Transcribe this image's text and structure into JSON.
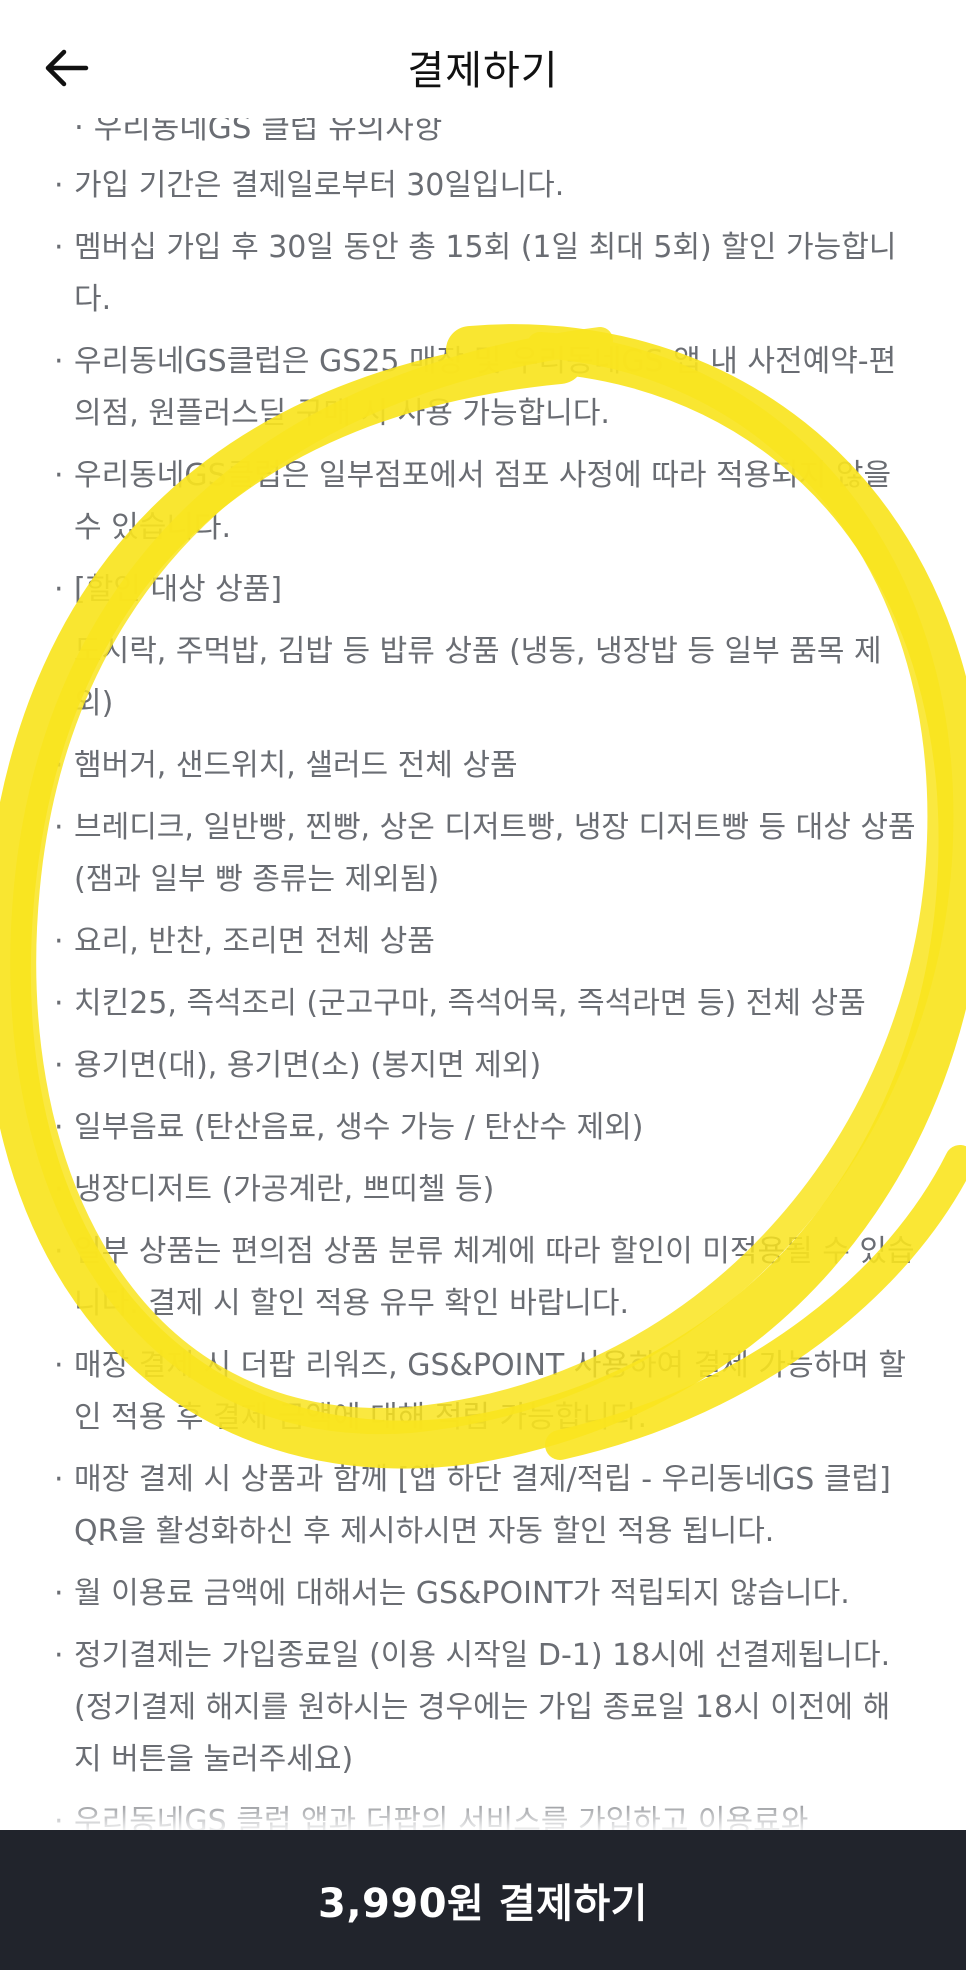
{
  "header": {
    "title": "결제하기",
    "back_icon": "arrow-left-icon"
  },
  "content": {
    "cut_off_heading": "· 우리동네GS 클럽 유의사항",
    "notes": [
      {
        "bullet": "·",
        "text": "가입 기간은 결제일로부터 30일입니다."
      },
      {
        "bullet": "·",
        "text": "멤버십 가입 후 30일 동안 총 15회 (1일 최대 5회) 할인 가능합니다."
      },
      {
        "bullet": "·",
        "text": "우리동네GS클럽은 GS25 매장 및 우리동네GS 앱 내 사전예약-편의점, 원플러스딜 구매 시 사용 가능합니다."
      },
      {
        "bullet": "·",
        "text": "우리동네GS클럽은 일부점포에서 점포 사정에 따라 적용되지 않을 수 있습니다."
      },
      {
        "bullet": "·",
        "text": "[할인 대상 상품]"
      },
      {
        "bullet": "",
        "text": "도시락, 주먹밥, 김밥 등 밥류 상품 (냉동, 냉장밥 등 일부 품목 제외)"
      },
      {
        "bullet": "·",
        "text": "햄버거, 샌드위치, 샐러드 전체 상품"
      },
      {
        "bullet": "·",
        "text": "브레디크, 일반빵, 찐빵, 상온 디저트빵, 냉장 디저트빵 등 대상 상품 (잼과 일부 빵 종류는 제외됨)"
      },
      {
        "bullet": "·",
        "text": "요리, 반찬, 조리면 전체 상품"
      },
      {
        "bullet": "·",
        "text": "치킨25, 즉석조리 (군고구마, 즉석어묵, 즉석라면 등) 전체 상품"
      },
      {
        "bullet": "·",
        "text": "용기면(대), 용기면(소) (봉지면 제외)"
      },
      {
        "bullet": "·",
        "text": "일부음료 (탄산음료, 생수 가능 / 탄산수 제외)"
      },
      {
        "bullet": "·",
        "text": "냉장디저트 (가공계란, 쁘띠첼 등)"
      },
      {
        "bullet": "·",
        "text": "일부 상품는 편의점 상품 분류 체계에 따라 할인이 미적용될 수 있습니다. 결제 시 할인 적용 유무 확인 바랍니다."
      },
      {
        "bullet": "·",
        "text": "매장 결제 시 더팝 리워즈, GS&POINT 사용하여 결제 가능하며 할인 적용 후 결제 금액에 대해 적립 가능합니다."
      },
      {
        "bullet": "·",
        "text": "매장 결제 시 상품과 함께 [앱 하단 결제/적립 - 우리동네GS 클럽] QR을 활성화하신 후 제시하시면 자동 할인 적용 됩니다."
      },
      {
        "bullet": "·",
        "text": "월 이용료 금액에 대해서는 GS&POINT가 적립되지 않습니다."
      },
      {
        "bullet": "·",
        "text": "정기결제는 가입종료일 (이용 시작일 D-1) 18시에 선결제됩니다. (정기결제 해지를 원하시는 경우에는 가입 종료일 18시 이전에 해지 버튼을 눌러주세요)"
      },
      {
        "bullet": "·",
        "text": "우리동네GS 클럽 앱과 더팝의 서비스를 가입하고 이용료와"
      }
    ]
  },
  "annotation": {
    "shape": "hand-drawn circle",
    "color": "#f9e41f"
  },
  "footer": {
    "pay_button_label": "3,990원 결제하기",
    "background": "#21242c"
  }
}
